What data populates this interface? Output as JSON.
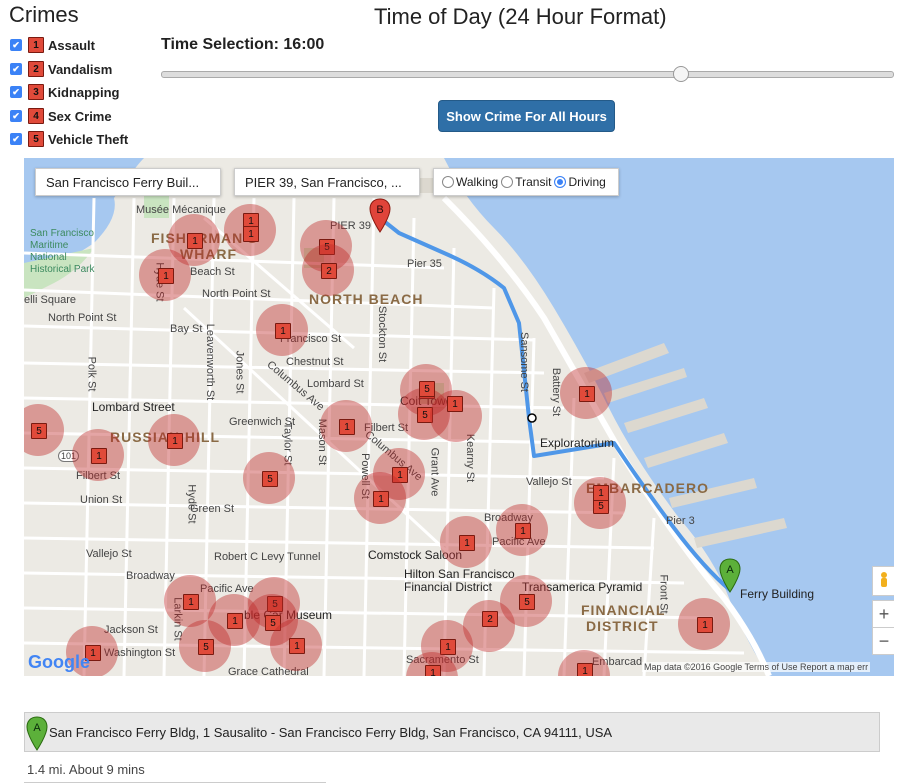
{
  "crimes_title": "Crimes",
  "crimes": [
    {
      "num": "1",
      "label": "Assault"
    },
    {
      "num": "2",
      "label": "Vandalism"
    },
    {
      "num": "3",
      "label": "Kidnapping"
    },
    {
      "num": "4",
      "label": "Sex Crime"
    },
    {
      "num": "5",
      "label": "Vehicle Theft"
    }
  ],
  "time_of_day_title": "Time of Day (24 Hour Format)",
  "time_selection": "Time Selection: 16:00",
  "slider_value_fraction": 0.71,
  "show_all_button": "Show Crime For All Hours",
  "map": {
    "origin_input": "San Francisco Ferry Buil...",
    "destination_input": "PIER 39, San Francisco, ...",
    "modes": [
      "Walking",
      "Transit",
      "Driving"
    ],
    "selected_mode": "Driving",
    "labels": {
      "musee": "Musée Mécanique",
      "fishermans": "FISHERMAN'S",
      "wharf": "WHARF",
      "maritime1": "San Francisco",
      "maritime2": "Maritime",
      "maritime3": "National",
      "maritime4": "Historical Park",
      "north_beach": "NORTH BEACH",
      "russian_hill": "RUSSIAN HILL",
      "embarcadero": "EMBARCADERO",
      "financial": "FINANCIAL",
      "district": "DISTRICT",
      "pier39": "PIER 39",
      "pier35": "Pier 35",
      "pier3": "Pier 3",
      "ghirardelli": "elli Square",
      "beach_st": "Beach St",
      "north_point": "North Point St",
      "north_point2": "North Point St",
      "bay_st": "Bay St",
      "francisco": "Francisco St",
      "chestnut": "Chestnut St",
      "lombard": "Lombard St",
      "lombard_street": "Lombard Street",
      "greenwich": "Greenwich St",
      "filbert": "Filbert St",
      "filbert2": "Filbert St",
      "union": "Union St",
      "green": "Green St",
      "vallejo": "Vallejo St",
      "vallejo2": "Vallejo St",
      "broadway": "Broadway",
      "broadway2": "Broadway",
      "pacific": "Pacific Ave",
      "pacific2": "Pacific Ave",
      "jackson": "Jackson St",
      "washington": "Washington St",
      "sacramento": "Sacramento St",
      "tunnel": "Robert C Levy Tunnel",
      "coit": "Coit Tower",
      "exploratorium": "Exploratorium",
      "comstock": "Comstock Saloon",
      "hilton": "Hilton San Francisco",
      "hilton2": "Financial District",
      "transamerica": "Transamerica Pyramid",
      "cable_car": "ble Car Museum",
      "ferry": "Ferry Building",
      "grace": "Grace Cathedral",
      "embarcadero_station": "Embarcad",
      "hyde": "Hyde St",
      "hyde2": "Hyde St",
      "polk": "Polk St",
      "larkin": "Larkin St",
      "leavenworth": "Leavenworth St",
      "jones": "Jones St",
      "taylor": "Taylor St",
      "mason": "Mason St",
      "columbus": "Columbus Ave",
      "columbus2": "Columbus Ave",
      "stockton": "Stockton St",
      "powell": "Powell St",
      "grant": "Grant Ave",
      "kearny": "Kearny St",
      "sansome": "Sansome St",
      "battery": "Battery St",
      "front": "Front St",
      "hwy101": "101",
      "marker_a": "A",
      "marker_b": "B"
    },
    "pins": [
      {
        "n": "1"
      },
      {
        "n": "1"
      },
      {
        "n": "1"
      },
      {
        "n": "1"
      },
      {
        "n": "5"
      },
      {
        "n": "2"
      },
      {
        "n": "1"
      },
      {
        "n": "5"
      },
      {
        "n": "1"
      },
      {
        "n": "1"
      },
      {
        "n": "5"
      },
      {
        "n": "1"
      },
      {
        "n": "1"
      },
      {
        "n": "5"
      },
      {
        "n": "1"
      },
      {
        "n": "5"
      },
      {
        "n": "1"
      },
      {
        "n": "1"
      },
      {
        "n": "1"
      },
      {
        "n": "5"
      },
      {
        "n": "1"
      },
      {
        "n": "1"
      },
      {
        "n": "1"
      },
      {
        "n": "5"
      },
      {
        "n": "2"
      },
      {
        "n": "1"
      },
      {
        "n": "1"
      },
      {
        "n": "1"
      },
      {
        "n": "5"
      },
      {
        "n": "5"
      },
      {
        "n": "1"
      },
      {
        "n": "1"
      },
      {
        "n": "5"
      },
      {
        "n": "1"
      },
      {
        "n": "1"
      },
      {
        "n": "1"
      }
    ],
    "zoom_in": "+",
    "zoom_out": "−",
    "google": "Google",
    "footer": "Map data ©2016 Google    Terms of Use    Report a map err"
  },
  "route": {
    "marker": "A",
    "address": "San Francisco Ferry Bldg, 1 Sausalito - San Francisco Ferry Bldg, San Francisco, CA 94111, USA",
    "summary": "1.4 mi. About 9 mins"
  }
}
